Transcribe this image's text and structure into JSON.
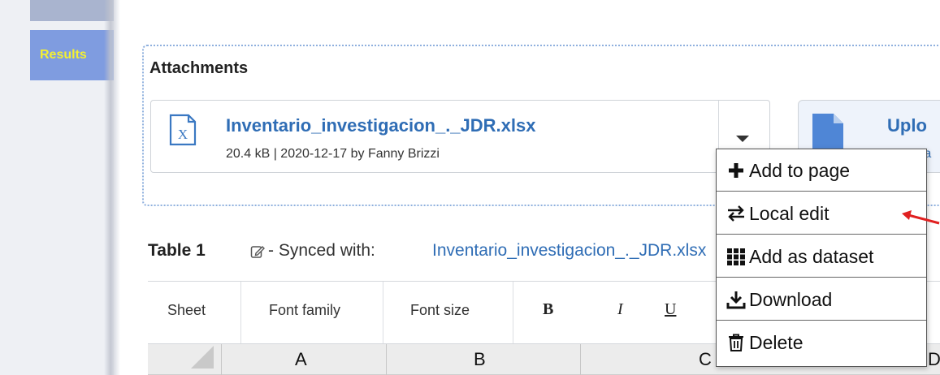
{
  "sidebar": {
    "results_label": "Results"
  },
  "attachments": {
    "title": "Attachments",
    "file": {
      "name": "Inventario_investigacion_._JDR.xlsx",
      "meta": "20.4 kB | 2020-12-17 by Fanny Brizzi",
      "icon": "excel-file-icon"
    },
    "upload": {
      "label": "Uplo",
      "sub": "ra",
      "icon": "upload-file-icon"
    }
  },
  "table": {
    "title": "Table 1",
    "synced_prefix": "- Synced with:",
    "synced_file": "Inventario_investigacion_._JDR.xlsx"
  },
  "toolbar": {
    "sheet": "Sheet",
    "font_family": "Font family",
    "font_size": "Font size",
    "bold": "B",
    "italic": "I",
    "underline": "U"
  },
  "columns": [
    "A",
    "B",
    "C",
    "D"
  ],
  "menu": {
    "items": [
      {
        "label": "Add to page",
        "icon": "plus-icon"
      },
      {
        "label": "Local edit",
        "icon": "swap-arrows-icon"
      },
      {
        "label": "Add as dataset",
        "icon": "grid-icon"
      },
      {
        "label": "Download",
        "icon": "download-icon"
      },
      {
        "label": "Delete",
        "icon": "trash-icon"
      }
    ]
  },
  "colors": {
    "link": "#2f6db5",
    "results_tab_bg": "#7f9ce0",
    "results_tab_text": "#f4f032",
    "annotation_arrow": "#e02020"
  }
}
